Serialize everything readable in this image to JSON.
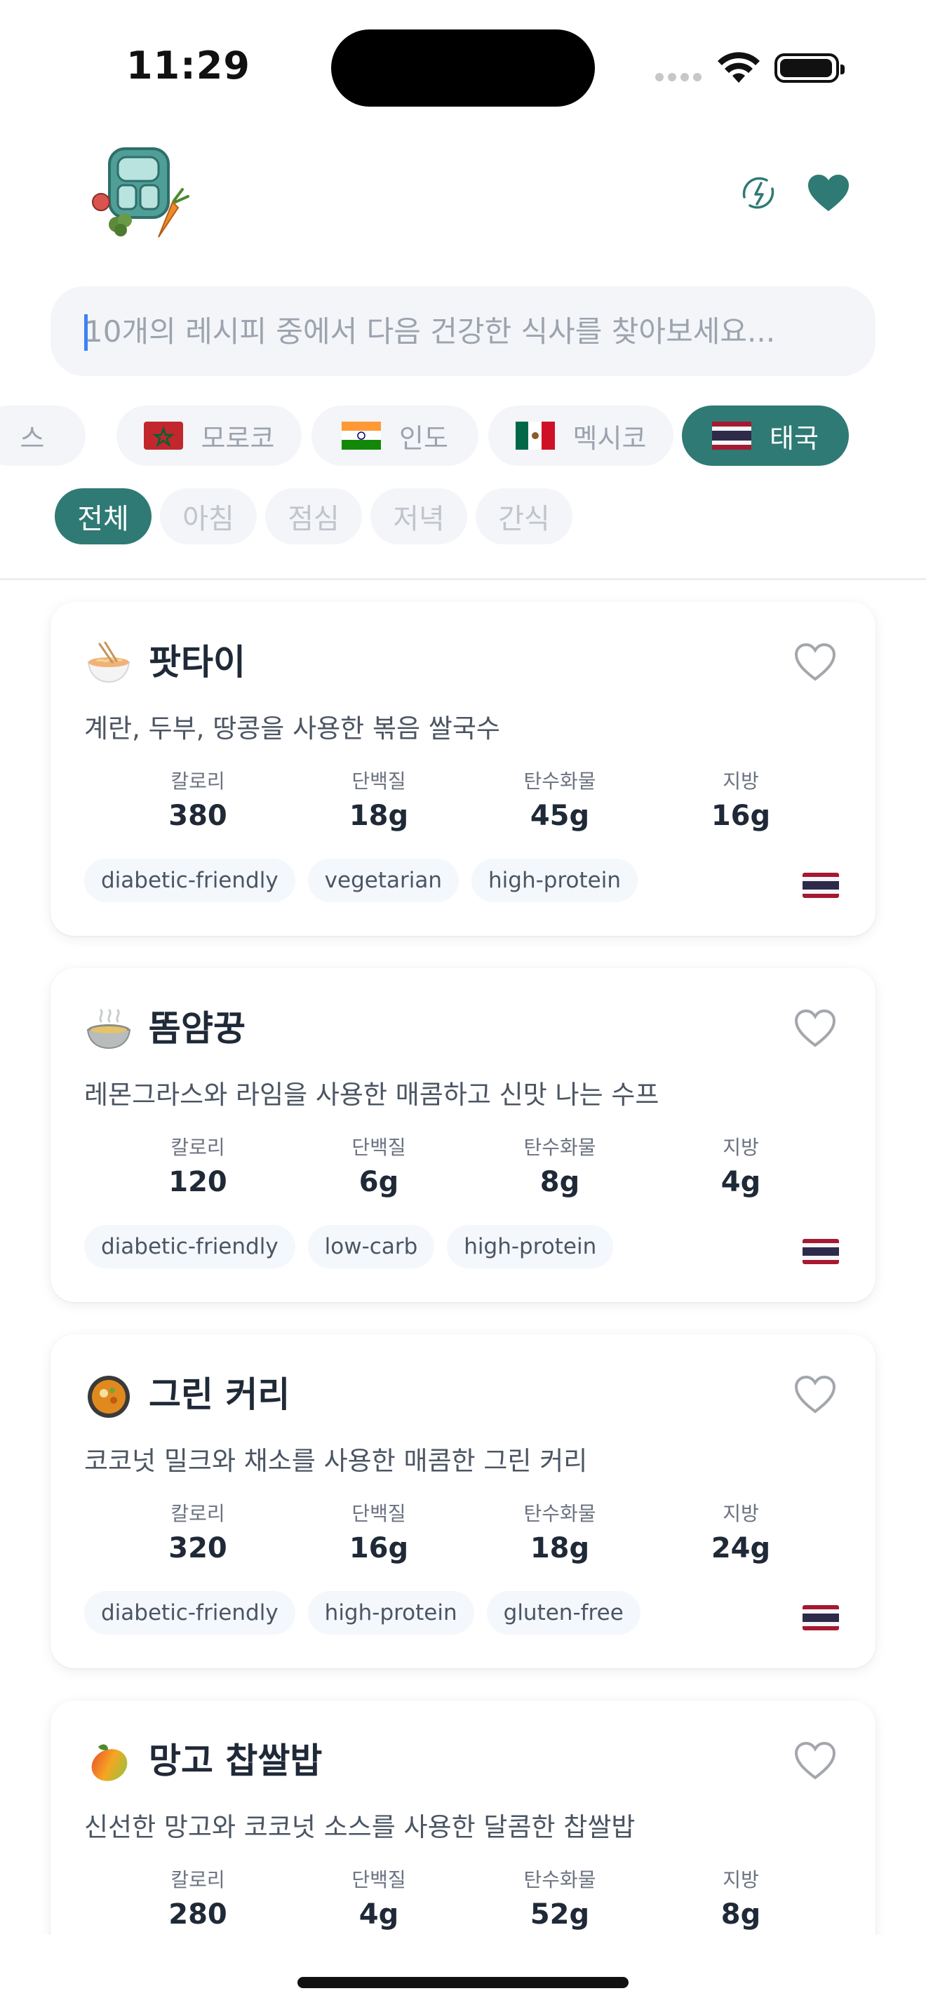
{
  "status": {
    "time": "11:29"
  },
  "search": {
    "placeholder": "10개의 레시피 중에서 다음 건강한 식사를 찾아보세요..."
  },
  "countries": [
    {
      "label": "스",
      "flag": ""
    },
    {
      "label": "모로코",
      "flag": "morocco"
    },
    {
      "label": "인도",
      "flag": "india"
    },
    {
      "label": "멕시코",
      "flag": "mexico"
    },
    {
      "label": "태국",
      "flag": "thailand",
      "active": true
    }
  ],
  "meals": [
    {
      "label": "전체",
      "active": true
    },
    {
      "label": "아침"
    },
    {
      "label": "점심"
    },
    {
      "label": "저녁"
    },
    {
      "label": "간식"
    }
  ],
  "nutrition_labels": {
    "calories": "칼로리",
    "protein": "단백질",
    "carbs": "탄수화물",
    "fat": "지방"
  },
  "recipes": [
    {
      "emoji": "noodle-bowl-icon",
      "title": "팟타이",
      "description": "계란, 두부, 땅콩을 사용한 볶음 쌀국수",
      "calories": "380",
      "protein": "18g",
      "carbs": "45g",
      "fat": "16g",
      "tags": [
        "diabetic-friendly",
        "vegetarian",
        "high-protein"
      ],
      "country": "thailand"
    },
    {
      "emoji": "soup-bowl-icon",
      "title": "똠얌꿍",
      "description": "레몬그라스와 라임을 사용한 매콤하고 신맛 나는 수프",
      "calories": "120",
      "protein": "6g",
      "carbs": "8g",
      "fat": "4g",
      "tags": [
        "diabetic-friendly",
        "low-carb",
        "high-protein"
      ],
      "country": "thailand"
    },
    {
      "emoji": "curry-pan-icon",
      "title": "그린 커리",
      "description": "코코넛 밀크와 채소를 사용한 매콤한 그린 커리",
      "calories": "320",
      "protein": "16g",
      "carbs": "18g",
      "fat": "24g",
      "tags": [
        "diabetic-friendly",
        "high-protein",
        "gluten-free"
      ],
      "country": "thailand"
    },
    {
      "emoji": "mango-icon",
      "title": "망고 찹쌀밥",
      "description": "신선한 망고와 코코넛 소스를 사용한 달콤한 찹쌀밥",
      "calories": "280",
      "protein": "4g",
      "carbs": "52g",
      "fat": "8g",
      "tags": [],
      "country": "thailand"
    }
  ],
  "colors": {
    "accent": "#2f7a74",
    "chip_bg": "#f3f5f8",
    "heart_outline": "#9ca3af"
  }
}
